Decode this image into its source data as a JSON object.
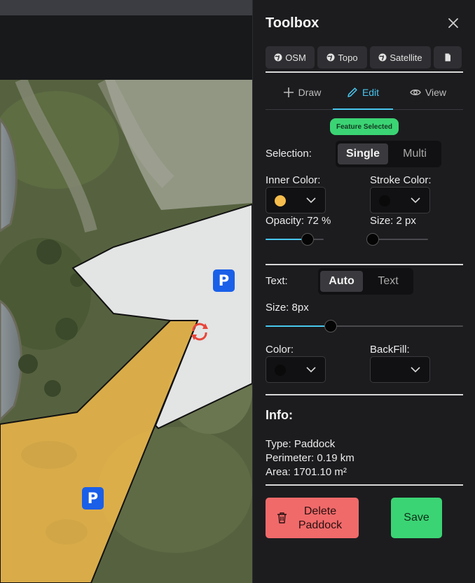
{
  "map": {
    "parking_label": "P",
    "polygon_colors": {
      "selected_fill": "#f6bd4c",
      "unselected_fill": "#e3e4e4",
      "stroke": "#111111"
    }
  },
  "toolbox": {
    "title": "Toolbox",
    "close_icon": "close-icon",
    "layers": [
      {
        "label": "OSM",
        "icon": "globe-icon"
      },
      {
        "label": "Topo",
        "icon": "globe-icon"
      },
      {
        "label": "Satellite",
        "icon": "globe-icon"
      },
      {
        "label": "",
        "icon": "document-icon"
      }
    ],
    "modes": [
      {
        "label": "Draw",
        "icon": "plus-icon",
        "active": false
      },
      {
        "label": "Edit",
        "icon": "pencil-icon",
        "active": true
      },
      {
        "label": "View",
        "icon": "eye-icon",
        "active": false
      }
    ],
    "status_badge": "Feature Selected",
    "selection": {
      "label": "Selection:",
      "options": [
        "Single",
        "Multi"
      ],
      "active": "Single"
    },
    "inner_color": {
      "label": "Inner Color:",
      "value": "#f6bd4c"
    },
    "stroke_color": {
      "label": "Stroke Color:",
      "value": "#0a0a0a"
    },
    "opacity": {
      "label": "Opacity: 72 %",
      "percent": 72
    },
    "size": {
      "label": "Size: 2 px",
      "percent": 0
    },
    "text_mode": {
      "label": "Text:",
      "options": [
        "Auto",
        "Text"
      ],
      "active": "Auto"
    },
    "text_size": {
      "label": "Size: 8px",
      "percent": 33
    },
    "text_color": {
      "label": "Color:",
      "value": "#0a0a0a"
    },
    "backfill": {
      "label": "BackFill:",
      "value": "#111113"
    },
    "info": {
      "title": "Info:",
      "type": "Type: Paddock",
      "perimeter": "Perimeter: 0.19 km",
      "area": "Area: 1701.10 m²"
    },
    "delete_label": "Delete Paddock",
    "save_label": "Save",
    "accent_color": "#48c7ee",
    "success_color": "#3bd474",
    "danger_color": "#f06a6a"
  }
}
